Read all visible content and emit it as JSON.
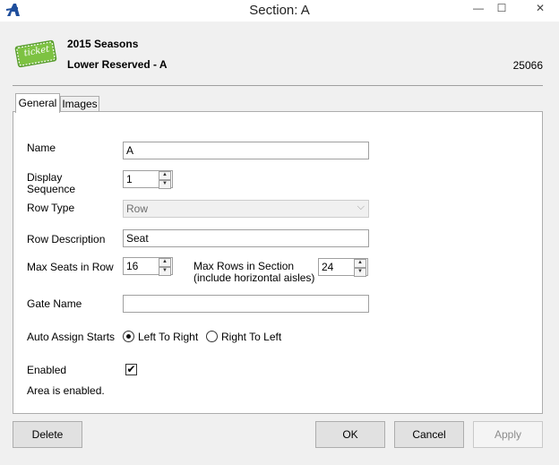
{
  "window": {
    "title": "Section: A",
    "minimize_glyph": "—",
    "maximize_glyph": "☐",
    "close_glyph": "✕"
  },
  "header": {
    "ticket_text": "ticket",
    "season": "2015 Seasons",
    "section": "Lower Reserved - A",
    "id": "25066"
  },
  "tabs": [
    {
      "label": "General",
      "active": true
    },
    {
      "label": "Images",
      "active": false
    }
  ],
  "form": {
    "name_label": "Name",
    "name_value": "A",
    "display_sequence_label_1": "Display",
    "display_sequence_label_2": "Sequence",
    "display_sequence_value": "1",
    "row_type_label": "Row Type",
    "row_type_value": "Row",
    "row_description_label": "Row Description",
    "row_description_value": "Seat",
    "max_seats_label": "Max Seats in Row",
    "max_seats_value": "16",
    "max_rows_label_1": "Max Rows in Section",
    "max_rows_label_2": "(include horizontal aisles)",
    "max_rows_value": "24",
    "gate_name_label": "Gate Name",
    "gate_name_value": "",
    "auto_assign_label": "Auto Assign Starts",
    "left_to_right_label": "Left To Right",
    "right_to_left_label": "Right To Left",
    "auto_assign_selected": "left_to_right",
    "enabled_label": "Enabled",
    "enabled_checked": true,
    "status_text": "Area is enabled."
  },
  "buttons": {
    "delete": "Delete",
    "ok": "OK",
    "cancel": "Cancel",
    "apply": "Apply"
  },
  "colors": {
    "ticket_green": "#7dc242",
    "logo_blue": "#1f4e9c"
  }
}
